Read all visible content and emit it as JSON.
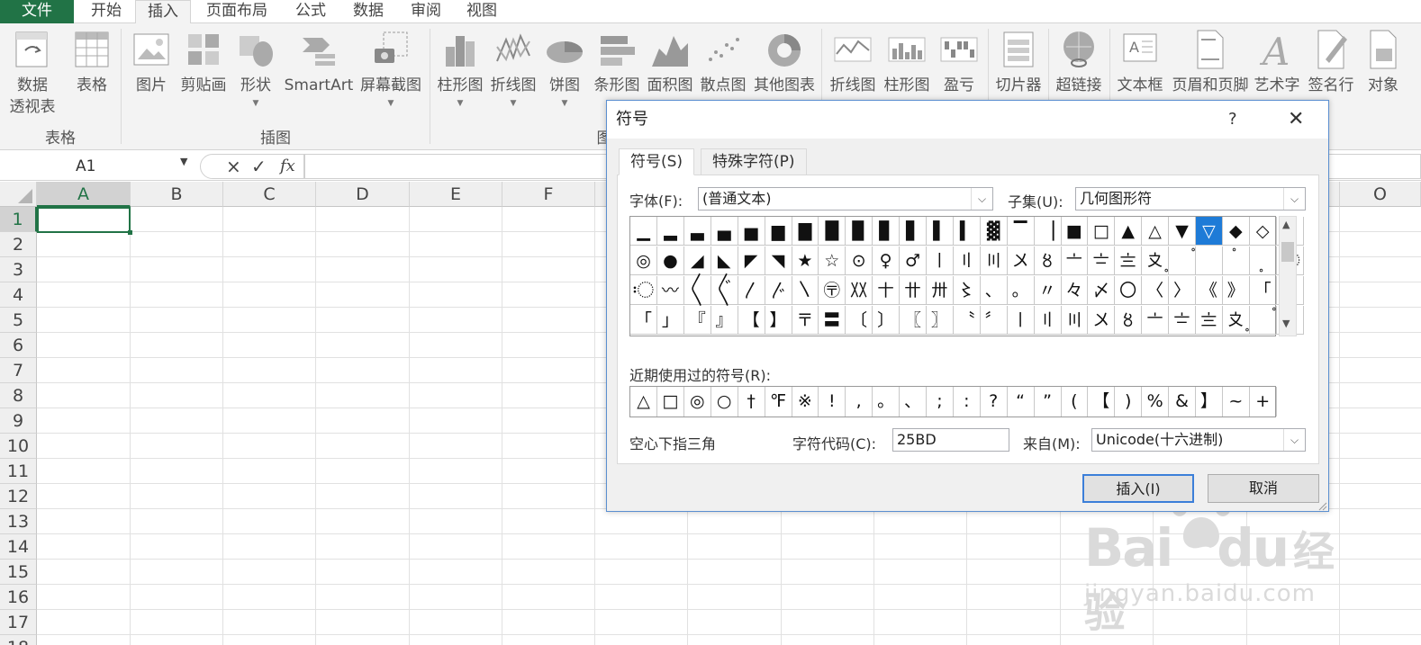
{
  "menu": {
    "tabs": [
      "文件",
      "开始",
      "插入",
      "页面布局",
      "公式",
      "数据",
      "审阅",
      "视图"
    ]
  },
  "ribbon": {
    "buttons": [
      {
        "label": "数据",
        "label2": "透视表"
      },
      {
        "label": "表格"
      },
      {
        "label": "图片"
      },
      {
        "label": "剪贴画"
      },
      {
        "label": "形状"
      },
      {
        "label": "SmartArt"
      },
      {
        "label": "屏幕截图"
      },
      {
        "label": "柱形图"
      },
      {
        "label": "折线图"
      },
      {
        "label": "饼图"
      },
      {
        "label": "条形图"
      },
      {
        "label": "面积图"
      },
      {
        "label": "散点图"
      },
      {
        "label": "其他图表"
      },
      {
        "label": "折线图"
      },
      {
        "label": "柱形图"
      },
      {
        "label": "盈亏"
      },
      {
        "label": "切片器"
      },
      {
        "label": "超链接"
      },
      {
        "label": "文本框"
      },
      {
        "label": "页眉和页脚"
      },
      {
        "label": "艺术字"
      },
      {
        "label": "签名行"
      },
      {
        "label": "对象"
      }
    ],
    "groups": [
      "表格",
      "插图",
      "图"
    ]
  },
  "formula_bar": {
    "name_box": "A1",
    "cancel_icon": "×",
    "enter_icon": "✓",
    "fx_label": "fx"
  },
  "sheet": {
    "columns": [
      "A",
      "B",
      "C",
      "D",
      "E",
      "F",
      "O"
    ],
    "rows": [
      "1",
      "2",
      "3",
      "4",
      "5",
      "6",
      "7",
      "8",
      "9",
      "10",
      "11",
      "12",
      "13",
      "14",
      "15",
      "16",
      "17",
      "18"
    ],
    "active_cell": "A1"
  },
  "dialog": {
    "title": "符号",
    "help": "?",
    "close": "✕",
    "tabs": [
      "符号(S)",
      "特殊字符(P)"
    ],
    "font_label": "字体(F):",
    "font_value": "(普通文本)",
    "subset_label": "子集(U):",
    "subset_value": "几何图形符",
    "symbols": [
      [
        "▁",
        "▂",
        "▃",
        "▄",
        "▅",
        "▆",
        "▇",
        "█",
        "▉",
        "▊",
        "▋",
        "▌",
        "▍",
        "▓",
        "▔",
        "▕",
        "■",
        "□",
        "▲",
        "△",
        "▼",
        "▽",
        "◆",
        "◇",
        "○"
      ],
      [
        "◎",
        "●",
        "◢",
        "◣",
        "◤",
        "◥",
        "★",
        "☆",
        "⊙",
        "♀",
        "♂",
        "〡",
        "〢",
        "〣",
        "〤",
        "〥",
        "〦",
        "〧",
        "〨",
        "〩",
        "〪",
        "〫",
        "〬",
        "〭",
        "〮"
      ],
      [
        "〯",
        "〰",
        "〱",
        "〲",
        "〳",
        "〴",
        "〵",
        "〶",
        "〷",
        "〸",
        "〹",
        "〺",
        "〻",
        "、",
        "。",
        "〃",
        "々",
        "〆",
        "〇",
        "〈",
        "〉",
        "《",
        "》",
        "「",
        "」"
      ],
      [
        "「",
        "」",
        "『",
        "』",
        "【",
        "】",
        "〒",
        "〓",
        "〔",
        "〕",
        "〖",
        "〗",
        "〝",
        "〞",
        "〡",
        "〢",
        "〣",
        "〤",
        "〥",
        "〦",
        "〧",
        "〨",
        "〩",
        "〪",
        "〫"
      ]
    ],
    "selected": "▽",
    "recent_label": "近期使用过的符号(R):",
    "recent": [
      "△",
      "□",
      "◎",
      "○",
      "†",
      "℉",
      "※",
      "!",
      ",",
      "。",
      "、",
      ";",
      ":",
      "?",
      "“",
      "”",
      "(",
      "【",
      ")",
      "%",
      "&",
      "】",
      "~",
      "+"
    ],
    "char_name": "空心下指三角",
    "code_label": "字符代码(C):",
    "code_value": "25BD",
    "from_label": "来自(M):",
    "from_value": "Unicode(十六进制)",
    "insert": "插入(I)",
    "cancel": "取消"
  },
  "watermark": {
    "brand": "Bai",
    "brand2": "du",
    "cn": "经验",
    "url": "jingyan.baidu.com"
  },
  "colors": {
    "excel_green": "#217346",
    "selected_blue": "#1e7bd7"
  }
}
